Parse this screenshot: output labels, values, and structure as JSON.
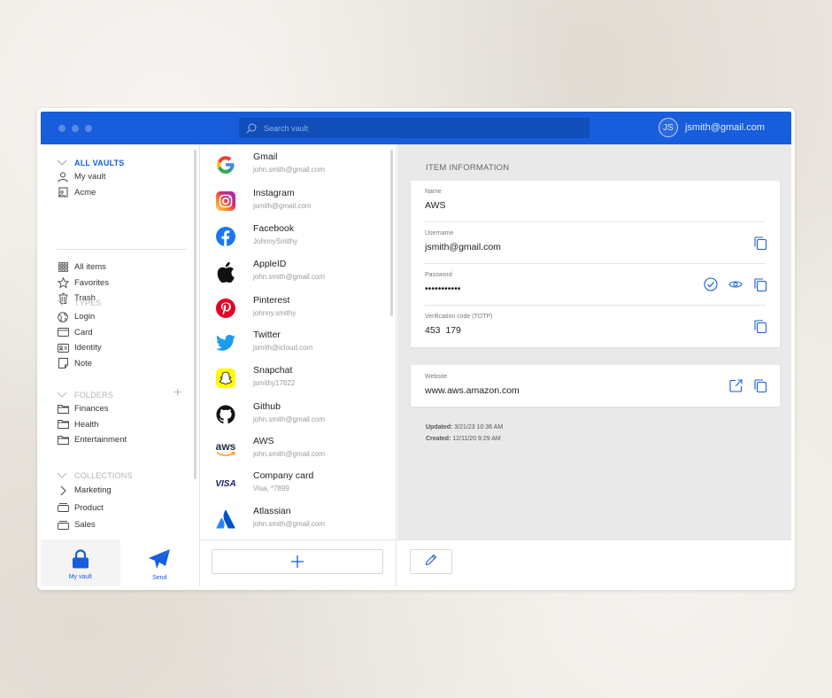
{
  "titlebar": {
    "search_placeholder": "Search vault",
    "avatar_initials": "JS",
    "account_email": "jsmith@gmail.com"
  },
  "sidebar": {
    "vaults_header": "ALL VAULTS",
    "vaults": [
      "My vault",
      "Acme"
    ],
    "main_items": [
      "All items",
      "Favorites",
      "Trash"
    ],
    "types_header": "TYPES",
    "types": [
      "Login",
      "Card",
      "Identity",
      "Note"
    ],
    "folders_header": "FOLDERS",
    "folders": [
      "Finances",
      "Health",
      "Entertainment"
    ],
    "collections_header": "COLLECTIONS",
    "collections": [
      "Marketing",
      "Product",
      "Sales"
    ]
  },
  "bottom_nav": {
    "my_vault": "My vault",
    "send": "Send"
  },
  "items": [
    {
      "name": "Gmail",
      "sub": "john.smith@gmail.com",
      "icon": "google-icon"
    },
    {
      "name": "Instagram",
      "sub": "jsmith@gmail.com",
      "icon": "instagram-icon"
    },
    {
      "name": "Facebook",
      "sub": "JohnnySmithy",
      "icon": "facebook-icon"
    },
    {
      "name": "AppleID",
      "sub": "john.smith@gmail.com",
      "icon": "apple-icon"
    },
    {
      "name": "Pinterest",
      "sub": "johnny.smithy",
      "icon": "pinterest-icon"
    },
    {
      "name": "Twitter",
      "sub": "jsmith@icloud.com",
      "icon": "twitter-icon"
    },
    {
      "name": "Snapchat",
      "sub": "jsmithy17822",
      "icon": "snapchat-icon"
    },
    {
      "name": "Github",
      "sub": "john.smith@gmail.com",
      "icon": "github-icon"
    },
    {
      "name": "AWS",
      "sub": "john.smith@gmail.com",
      "icon": "aws-icon",
      "logo_text": "aws"
    },
    {
      "name": "Company card",
      "sub": "Visa, *7899",
      "icon": "visa-icon",
      "logo_text": "VISA"
    },
    {
      "name": "Atlassian",
      "sub": "john.smith@gmail.com",
      "icon": "atlassian-icon"
    }
  ],
  "detail": {
    "section_title": "ITEM INFORMATION",
    "name_label": "Name",
    "name_value": "AWS",
    "username_label": "Username",
    "username_value": "jsmith@gmail.com",
    "password_label": "Password",
    "password_value": "•••••••••••",
    "totp_label": "Verification code (TOTP)",
    "totp_value": "453  179",
    "website_label": "Website",
    "website_value": "www.aws.amazon.com",
    "updated_label": "Updated:",
    "updated_value": "3/21/23 10:36 AM",
    "created_label": "Created:",
    "created_value": "12/11/20 9:29 AM"
  },
  "colors": {
    "brand": "#175ddc",
    "titlebar": "#175ddc",
    "search_bg": "#124eb9"
  }
}
